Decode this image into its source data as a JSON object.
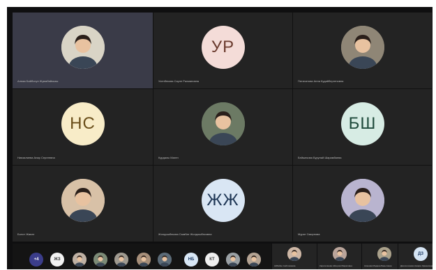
{
  "grid": {
    "tiles": [
      {
        "name": "Алмаз Байбосун Жумабайкызы",
        "initials": "",
        "avatar_type": "photo",
        "bg": "#d9d4c6",
        "active": true
      },
      {
        "name": "Усенбекова Сауле Рахмановна",
        "initials": "УР",
        "avatar_type": "initials",
        "bg": "#f4dcd8",
        "fg": "#6b3b2e"
      },
      {
        "name": "Пятихатова Анна Кудайбергеновна",
        "initials": "",
        "avatar_type": "photo",
        "bg": "#8f8676"
      },
      {
        "name": "Ниязалиева Анар Сергеевна",
        "initials": "НС",
        "avatar_type": "initials",
        "bg": "#f8ecc8",
        "fg": "#6a4e1a"
      },
      {
        "name": "Курдалы Маген",
        "initials": "",
        "avatar_type": "photo",
        "bg": "#6c7a64"
      },
      {
        "name": "Бейшекова Бурулай Шарамбаева",
        "initials": "БШ",
        "avatar_type": "initials",
        "bg": "#d7ece4",
        "fg": "#1e4a3b"
      },
      {
        "name": "Болот Жанат",
        "initials": "",
        "avatar_type": "photo",
        "bg": "#d8c1a7"
      },
      {
        "name": "Жолдошбекова Сымбат Жолдошбековна",
        "initials": "ЖЖ",
        "avatar_type": "initials",
        "bg": "#d9e6f4",
        "fg": "#1d3554"
      },
      {
        "name": "Мурат Смирнова",
        "initials": "",
        "avatar_type": "photo",
        "bg": "#b9b4cf"
      }
    ]
  },
  "strip": {
    "mini": [
      {
        "label": "+4",
        "type": "initials",
        "bg": "#3b3d8a",
        "fg": "#ffffff"
      },
      {
        "label": "ЖЗ",
        "type": "initials",
        "bg": "#f2f2f2",
        "fg": "#333333"
      },
      {
        "label": "",
        "type": "photo",
        "bg": "#bfb1a4"
      },
      {
        "label": "",
        "type": "photo",
        "bg": "#7c8b77"
      },
      {
        "label": "",
        "type": "photo",
        "bg": "#9f9a90"
      },
      {
        "label": "",
        "type": "photo",
        "bg": "#a78f7a"
      },
      {
        "label": "",
        "type": "photo",
        "bg": "#5c6b78"
      },
      {
        "label": "НБ",
        "type": "initials",
        "bg": "#d8e7f6",
        "fg": "#1f3b63"
      },
      {
        "label": "КТ",
        "type": "initials",
        "bg": "#efefef",
        "fg": "#444444"
      },
      {
        "label": "",
        "type": "photo",
        "bg": "#9aa0a4"
      },
      {
        "label": "",
        "type": "photo",
        "bg": "#b4a393"
      }
    ],
    "side": [
      {
        "name": "Айбийке Сейтказиева",
        "label": "",
        "type": "photo",
        "bg": "#cdb6a5"
      },
      {
        "name": "Караталиева Айгерим Маратовна",
        "label": "",
        "type": "photo",
        "bg": "#b9a49a"
      },
      {
        "name": "Асанова Мадина Бакытовна",
        "label": "",
        "type": "photo",
        "bg": "#a9a08a"
      },
      {
        "name": "Джолоочиева Назира Эрмековна",
        "label": "ДЗ",
        "type": "initials",
        "bg": "#d5e4f3",
        "fg": "#1f3b63"
      }
    ]
  }
}
